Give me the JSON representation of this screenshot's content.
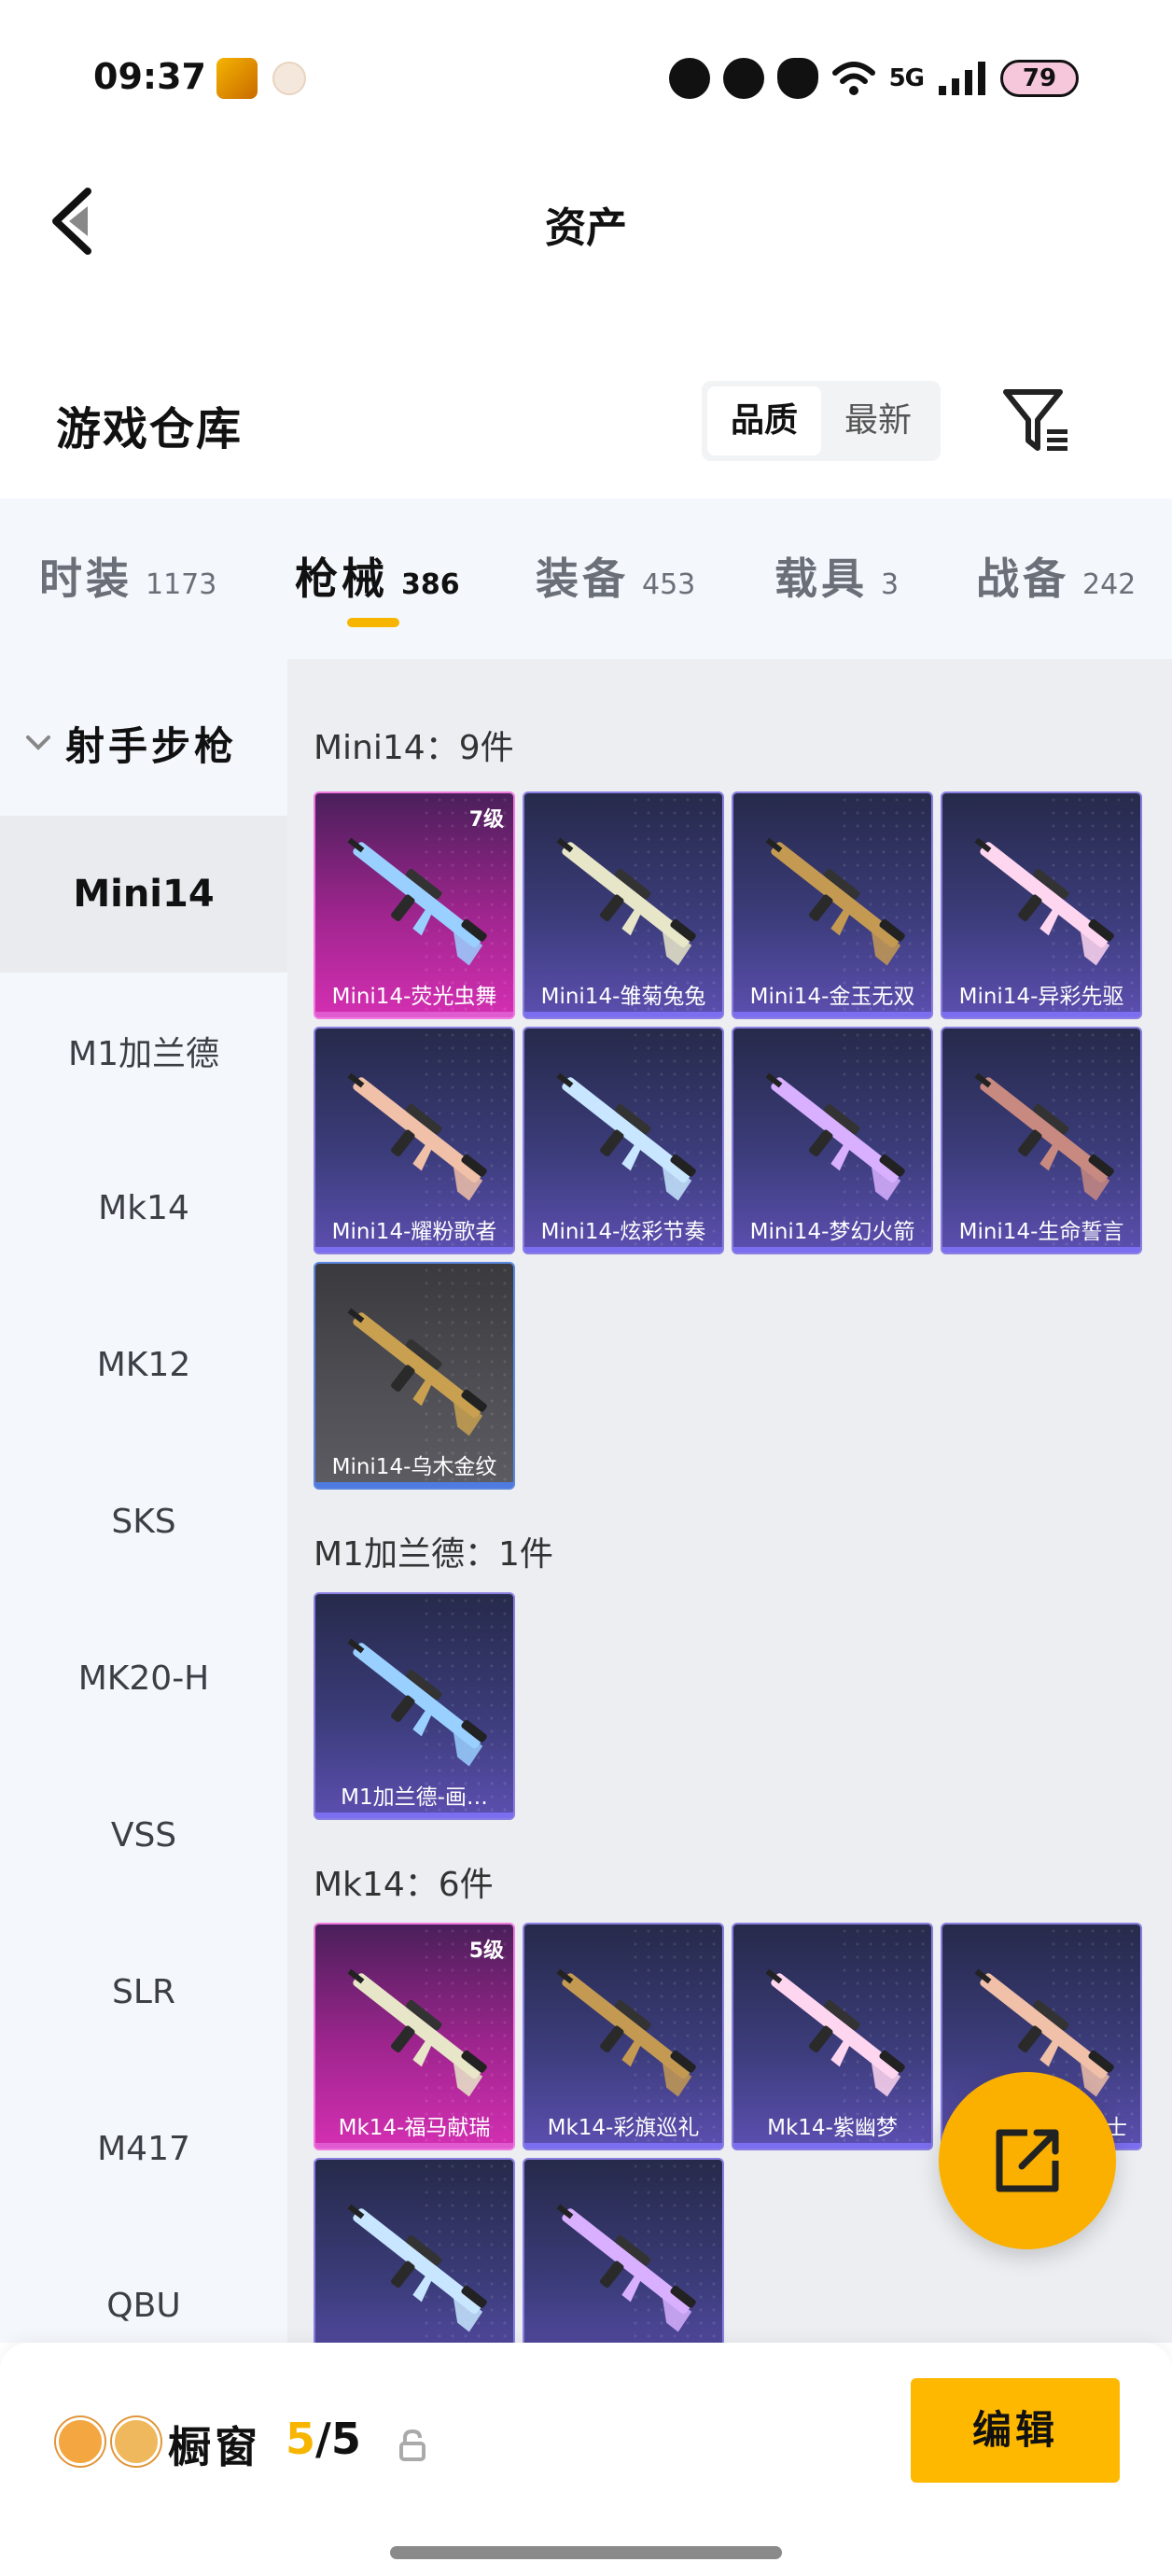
{
  "status_bar": {
    "time": "09:37",
    "signal": "5G",
    "battery": "79"
  },
  "header": {
    "title": "资产"
  },
  "warehouse": {
    "title": "游戏仓库",
    "sort_options": [
      "品质",
      "最新"
    ],
    "active_sort": "品质"
  },
  "tabs": [
    {
      "label": "时装",
      "count": "1173"
    },
    {
      "label": "枪械",
      "count": "386"
    },
    {
      "label": "装备",
      "count": "453"
    },
    {
      "label": "载具",
      "count": "3"
    },
    {
      "label": "战备",
      "count": "242"
    }
  ],
  "active_tab": "枪械",
  "sidebar": {
    "group_label": "射手步枪",
    "items": [
      "Mini14",
      "M1加兰德",
      "Mk14",
      "MK12",
      "SKS",
      "MK20-H",
      "VSS",
      "SLR",
      "M417",
      "QBU"
    ],
    "active_item": "Mini14"
  },
  "sections": [
    {
      "title": "Mini14：9件",
      "items": [
        {
          "name": "Mini14-荧光虫舞",
          "level": "7级",
          "rarity": "pink"
        },
        {
          "name": "Mini14-雏菊兔兔",
          "level": "",
          "rarity": "purple"
        },
        {
          "name": "Mini14-金玉无双",
          "level": "",
          "rarity": "purple"
        },
        {
          "name": "Mini14-异彩先驱",
          "level": "",
          "rarity": "purple"
        },
        {
          "name": "Mini14-耀粉歌者",
          "level": "",
          "rarity": "purple"
        },
        {
          "name": "Mini14-炫彩节奏",
          "level": "",
          "rarity": "purple"
        },
        {
          "name": "Mini14-梦幻火箭",
          "level": "",
          "rarity": "purple"
        },
        {
          "name": "Mini14-生命誓言",
          "level": "",
          "rarity": "purple"
        },
        {
          "name": "Mini14-乌木金纹",
          "level": "",
          "rarity": "gray"
        }
      ]
    },
    {
      "title": "M1加兰德：1件",
      "items": [
        {
          "name": "M1加兰德-画…",
          "level": "",
          "rarity": "purple"
        }
      ]
    },
    {
      "title": "Mk14：6件",
      "items": [
        {
          "name": "Mk14-福马献瑞",
          "level": "5级",
          "rarity": "pink"
        },
        {
          "name": "Mk14-彩旗巡礼",
          "level": "",
          "rarity": "purple"
        },
        {
          "name": "Mk14-紫幽梦",
          "level": "",
          "rarity": "purple"
        },
        {
          "name": "士",
          "level": "",
          "rarity": "purple"
        },
        {
          "name": "",
          "level": "",
          "rarity": "purple"
        },
        {
          "name": "",
          "level": "",
          "rarity": "purple"
        }
      ]
    }
  ],
  "bottom_bar": {
    "label": "橱窗",
    "current": "5",
    "separator": "/",
    "total": "5",
    "edit_label": "编辑"
  },
  "colors": {
    "accent": "#f7b500",
    "rarity_pink": "#d42fb2",
    "rarity_purple": "#5c4fb0",
    "rarity_gray": "#5c5c62"
  },
  "icons": [
    "back-arrow-icon",
    "filter-icon",
    "chevron-down-icon",
    "share-icon",
    "lock-icon"
  ]
}
